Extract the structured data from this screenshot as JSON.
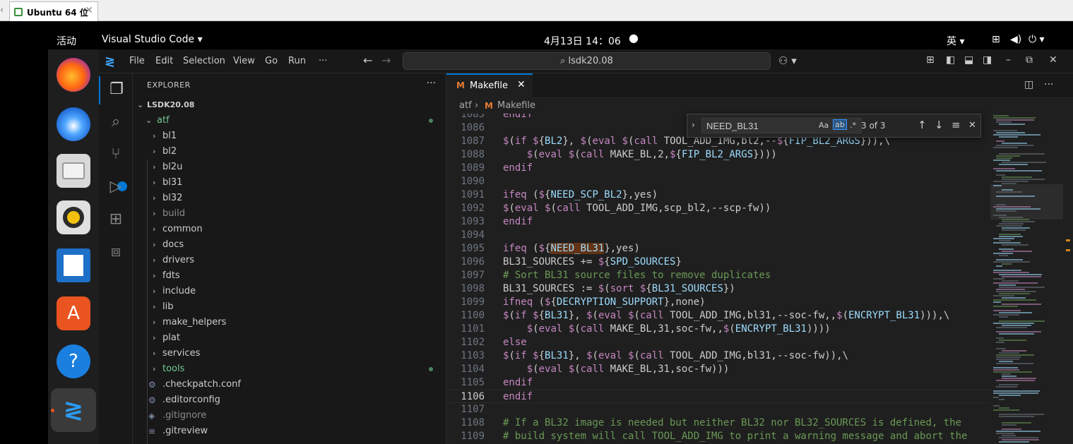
{
  "host": {
    "tab_title": "Ubuntu 64 位",
    "close": "✕"
  },
  "topbar": {
    "activities": "活动",
    "app_name": "Visual Studio Code ▾",
    "clock": "4月13日  14：06",
    "input_method": "英 ▾"
  },
  "dock": {
    "items": [
      "firefox-icon",
      "thunderbird-icon",
      "files-icon",
      "rhythmbox-icon",
      "writer-icon",
      "app-center-icon",
      "help-icon",
      "vscode-icon"
    ]
  },
  "titlebar": {
    "menus": [
      "File",
      "Edit",
      "Selection",
      "View",
      "Go",
      "Run",
      "···"
    ],
    "search": "lsdk20.08",
    "copilot": "⚇ ▾"
  },
  "sidebar": {
    "title": "EXPLORER",
    "more": "···",
    "root": "LSDK20.08",
    "open_folder": "atf",
    "folders": [
      "bl1",
      "bl2",
      "bl2u",
      "bl31",
      "bl32",
      "build",
      "common",
      "docs",
      "drivers",
      "fdts",
      "include",
      "lib",
      "make_helpers",
      "plat",
      "services",
      "tools"
    ],
    "files": [
      ".checkpatch.conf",
      ".editorconfig",
      ".gitignore",
      ".gitreview"
    ]
  },
  "editor": {
    "tab": {
      "label": "Makefile",
      "icon": "M"
    },
    "breadcrumb": {
      "folder": "atf",
      "sep": "›",
      "file": "Makefile",
      "icon": "M"
    },
    "lines": [
      {
        "n": "1085",
        "t": "endif"
      },
      {
        "n": "1086",
        "t": ""
      },
      {
        "n": "1087",
        "t": "$(if ${BL2}, $(eval $(call TOOL_ADD_IMG,bl2,--${FIP_BL2_ARGS})),\\"
      },
      {
        "n": "1088",
        "t": "    $(eval $(call MAKE_BL,2,${FIP_BL2_ARGS})))"
      },
      {
        "n": "1089",
        "t": "endif"
      },
      {
        "n": "1090",
        "t": ""
      },
      {
        "n": "1091",
        "t": "ifeq (${NEED_SCP_BL2},yes)"
      },
      {
        "n": "1092",
        "t": "$(eval $(call TOOL_ADD_IMG,scp_bl2,--scp-fw))"
      },
      {
        "n": "1093",
        "t": "endif"
      },
      {
        "n": "1094",
        "t": ""
      },
      {
        "n": "1095",
        "t": "ifeq (${NEED_BL31},yes)"
      },
      {
        "n": "1096",
        "t": "BL31_SOURCES += ${SPD_SOURCES}"
      },
      {
        "n": "1097",
        "t": "# Sort BL31 source files to remove duplicates"
      },
      {
        "n": "1098",
        "t": "BL31_SOURCES := $(sort ${BL31_SOURCES})"
      },
      {
        "n": "1099",
        "t": "ifneq (${DECRYPTION_SUPPORT},none)"
      },
      {
        "n": "1100",
        "t": "$(if ${BL31}, $(eval $(call TOOL_ADD_IMG,bl31,--soc-fw,,$(ENCRYPT_BL31))),\\"
      },
      {
        "n": "1101",
        "t": "    $(eval $(call MAKE_BL,31,soc-fw,,$(ENCRYPT_BL31))))"
      },
      {
        "n": "1102",
        "t": "else"
      },
      {
        "n": "1103",
        "t": "$(if ${BL31}, $(eval $(call TOOL_ADD_IMG,bl31,--soc-fw)),\\"
      },
      {
        "n": "1104",
        "t": "    $(eval $(call MAKE_BL,31,soc-fw)))"
      },
      {
        "n": "1105",
        "t": "endif"
      },
      {
        "n": "1106",
        "t": "endif"
      },
      {
        "n": "1107",
        "t": ""
      },
      {
        "n": "1108",
        "t": "# If a BL32 image is needed but neither BL32 nor BL32_SOURCES is defined, the"
      },
      {
        "n": "1109",
        "t": "# build system will call TOOL_ADD_IMG to print a warning message and abort the"
      }
    ],
    "current_line": "1106"
  },
  "find": {
    "value": "NEED_BL31",
    "match_case": "Aa",
    "whole_word": "ab",
    "regex": ".*",
    "count": "3 of 3"
  }
}
